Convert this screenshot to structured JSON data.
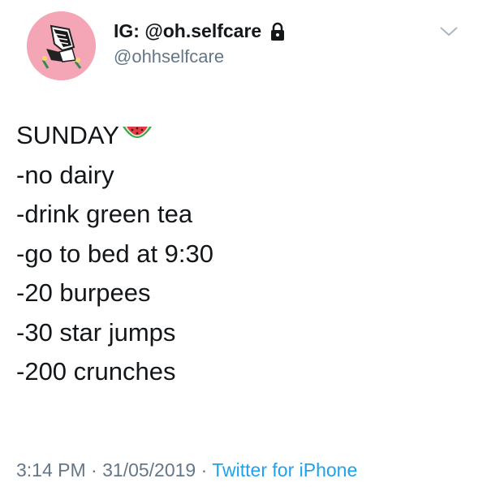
{
  "user": {
    "display_name": "IG: @oh.selfcare",
    "handle": "@ohhselfcare",
    "avatar_icon": "sneakers-avatar",
    "lock_icon": "lock-icon"
  },
  "tweet": {
    "heading": "SUNDAY",
    "heading_emoji": "watermelon-emoji",
    "lines": [
      "-no dairy",
      "-drink green tea",
      "-go to bed at 9:30",
      "-20 burpees",
      "-30 star jumps",
      "-200 crunches"
    ]
  },
  "meta": {
    "time": "3:14 PM",
    "date": "31/05/2019",
    "separator": " · ",
    "source": "Twitter for iPhone"
  },
  "colors": {
    "text": "#14171a",
    "secondary": "#657786",
    "link": "#1da1f2",
    "avatar_bg": "#f4a6b6"
  }
}
